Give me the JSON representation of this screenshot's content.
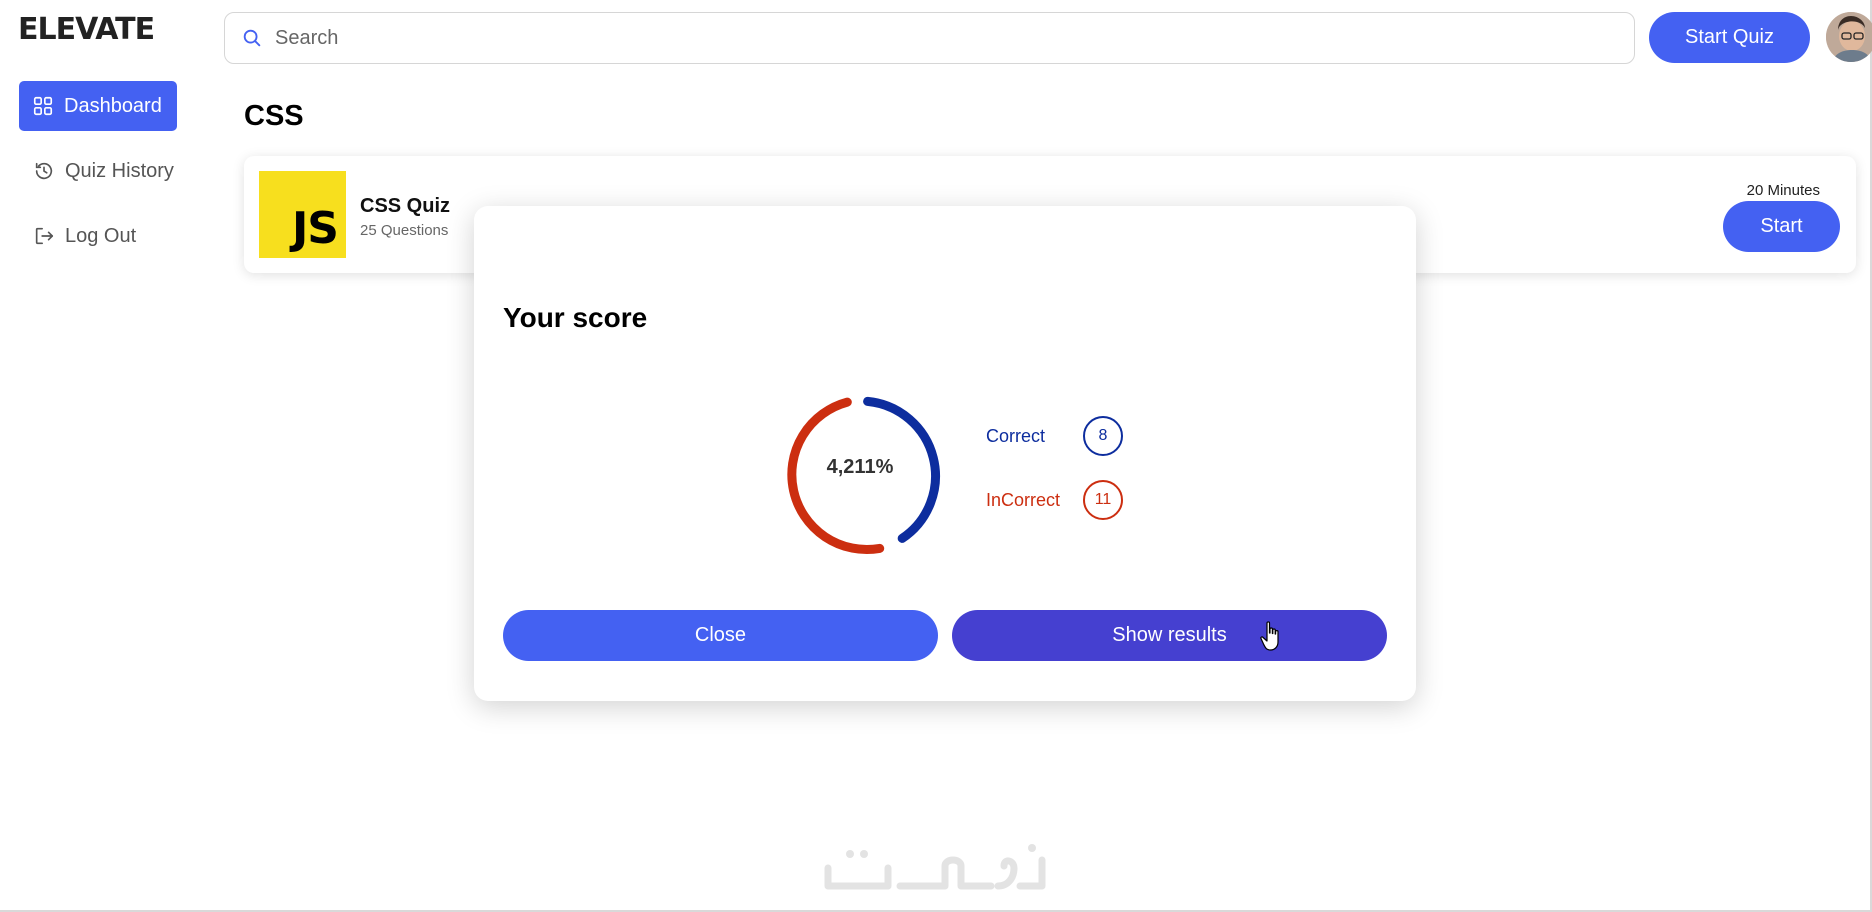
{
  "app": {
    "logo_text": "ELEVATE"
  },
  "sidebar": {
    "items": [
      {
        "label": "Dashboard",
        "icon": "grid-icon",
        "active": true
      },
      {
        "label": "Quiz History",
        "icon": "history-icon",
        "active": false
      },
      {
        "label": "Log Out",
        "icon": "logout-icon",
        "active": false
      }
    ]
  },
  "header": {
    "search_placeholder": "Search",
    "start_quiz_label": "Start Quiz",
    "avatar_icon": "user-avatar"
  },
  "main": {
    "title": "CSS",
    "quiz": {
      "logo_text": "JS",
      "title": "CSS Quiz",
      "questions": "25 Questions",
      "duration": "20 Minutes",
      "start_label": "Start"
    }
  },
  "modal": {
    "title": "Your score",
    "score_percent": "4,211%",
    "correct_label": "Correct",
    "correct_count": "8",
    "incorrect_label": "InCorrect",
    "incorrect_count": "11",
    "close_label": "Close",
    "show_results_label": "Show results"
  },
  "colors": {
    "primary": "#4461f2",
    "show_results_button": "#4540d0",
    "correct": "#0d2d9e",
    "incorrect": "#cc2e10",
    "js_logo": "#f7df1e"
  }
}
